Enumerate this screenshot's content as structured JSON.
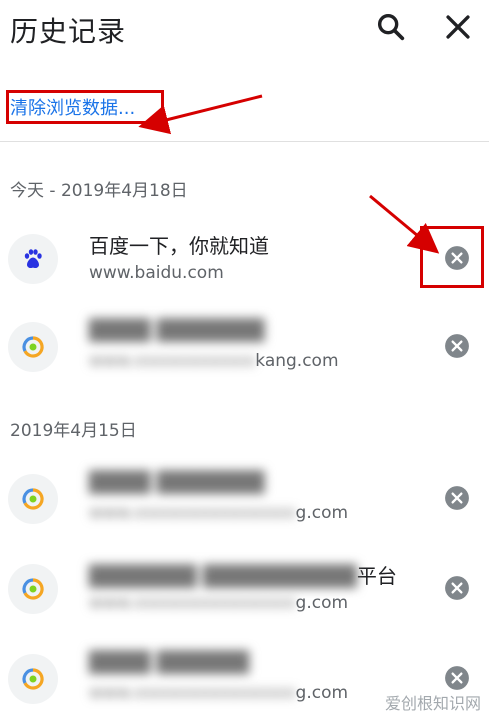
{
  "header": {
    "title": "历史记录",
    "search_icon": "search-icon",
    "close_icon": "close-icon"
  },
  "clear_browsing_data": "清除浏览数据...",
  "sections": [
    {
      "label": "今天 - 2019年4月18日",
      "items": [
        {
          "title": "百度一下，你就知道",
          "url": "www.baidu.com",
          "icon": "baidu-paw-icon"
        },
        {
          "title": "",
          "url": "kang.com",
          "icon": "site-favicon-icon",
          "blurred": true
        }
      ]
    },
    {
      "label": "2019年4月15日",
      "items": [
        {
          "title": "",
          "url": "g.com",
          "icon": "site-favicon-icon",
          "blurred": true
        },
        {
          "title": "平台",
          "url": "g.com",
          "icon": "site-favicon-icon",
          "blurred": true
        },
        {
          "title": "",
          "url": "g.com",
          "icon": "site-favicon-icon",
          "blurred": true
        }
      ]
    }
  ],
  "colors": {
    "accent": "#1a73e8",
    "annotation": "#d50000"
  },
  "watermark": "爱创根知识网"
}
